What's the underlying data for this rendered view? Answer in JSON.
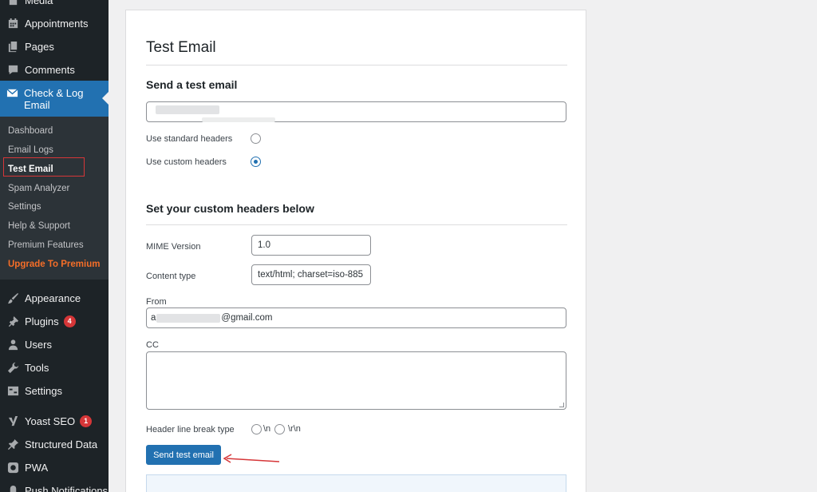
{
  "sidebar": {
    "items_top": [
      {
        "label": "Media",
        "icon": "media-icon"
      },
      {
        "label": "Appointments",
        "icon": "calendar-icon"
      },
      {
        "label": "Pages",
        "icon": "pages-icon"
      },
      {
        "label": "Comments",
        "icon": "comments-icon"
      }
    ],
    "active_parent": {
      "label": "Check & Log Email",
      "icon": "envelope-icon"
    },
    "submenu": [
      {
        "label": "Dashboard"
      },
      {
        "label": "Email Logs"
      },
      {
        "label": "Test Email"
      },
      {
        "label": "Spam Analyzer"
      },
      {
        "label": "Settings"
      },
      {
        "label": "Help & Support"
      },
      {
        "label": "Premium Features"
      },
      {
        "label": "Upgrade To Premium"
      }
    ],
    "items_bottom": [
      {
        "label": "Appearance",
        "icon": "paintbrush-icon"
      },
      {
        "label": "Plugins",
        "icon": "plugin-icon",
        "badge": "4"
      },
      {
        "label": "Users",
        "icon": "users-icon"
      },
      {
        "label": "Tools",
        "icon": "wrench-icon"
      },
      {
        "label": "Settings",
        "icon": "settings-icon"
      },
      {
        "label": "Yoast SEO",
        "icon": "yoast-icon",
        "badge": "1"
      },
      {
        "label": "Structured Data",
        "icon": "pin-icon"
      },
      {
        "label": "PWA",
        "icon": "pwa-icon"
      },
      {
        "label": "Push Notifications",
        "icon": "bell-icon"
      }
    ]
  },
  "content": {
    "title": "Test Email",
    "send_section": {
      "heading": "Send a test email",
      "recipient_value": "",
      "radio_standard_label": "Use standard headers",
      "radio_custom_label": "Use custom headers",
      "selected": "custom"
    },
    "headers_section": {
      "heading": "Set your custom headers below",
      "mime_label": "MIME Version",
      "mime_value": "1.0",
      "content_type_label": "Content type",
      "content_type_value": "text/html; charset=iso-885",
      "from_label": "From",
      "from_value_prefix": "a",
      "from_value_suffix": "@gmail.com",
      "cc_label": "CC",
      "cc_value": "",
      "line_break_label": "Header line break type",
      "line_break_options": [
        "\\n",
        "\\r\\n"
      ]
    },
    "send_button_label": "Send test email"
  },
  "colors": {
    "sidebar_bg": "#1d2327",
    "accent": "#2271b1",
    "premium": "#f56e28",
    "badge": "#d63638",
    "annotation": "#d63638"
  }
}
